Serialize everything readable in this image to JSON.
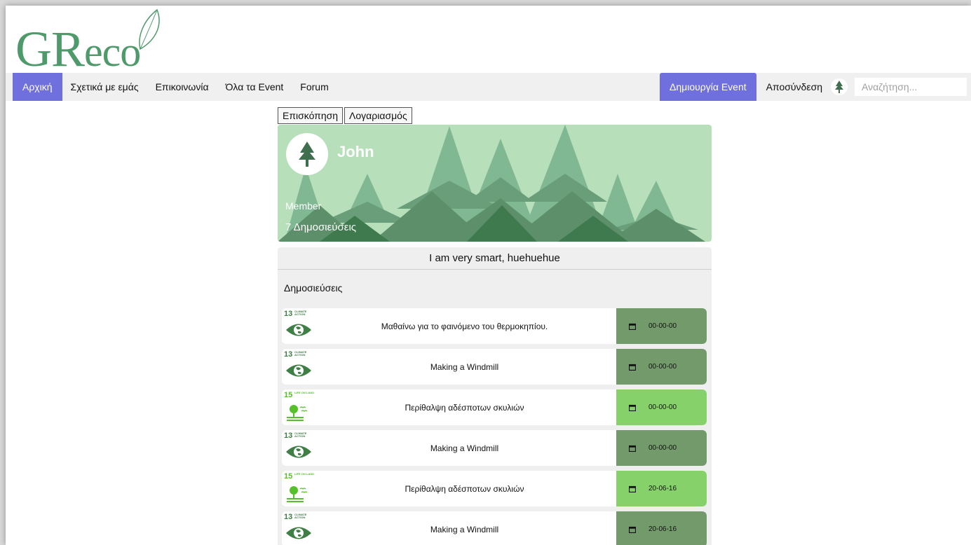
{
  "logo": {
    "text_main": "GR",
    "text_rest": "eco"
  },
  "nav": {
    "items": [
      {
        "label": "Αρχική",
        "active": true
      },
      {
        "label": "Σχετικά με εμάς",
        "active": false
      },
      {
        "label": "Επικοινωνία",
        "active": false
      },
      {
        "label": "Όλα τα Event",
        "active": false
      },
      {
        "label": "Forum",
        "active": false
      }
    ],
    "create_event_label": "Δημιουργία Event",
    "logout_label": "Αποσύνδεση",
    "search_placeholder": "Αναζήτηση..."
  },
  "tabs": [
    {
      "label": "Επισκόπηση"
    },
    {
      "label": "Λογαριασμός"
    }
  ],
  "profile": {
    "name": "John",
    "role": "Member",
    "posts_count": "7 Δημοσιεύσεις",
    "bio": "I am very smart, huehuehue"
  },
  "posts_heading": "Δημοσιεύσεις",
  "posts": [
    {
      "sdg": "13",
      "sdg_label": "CLIMATE ACTION",
      "icon": "eye-earth-icon",
      "title": "Μαθαίνω για το φαινόμενο του θερμοκηπίου.",
      "date": "00-00-00",
      "tone": "dark"
    },
    {
      "sdg": "13",
      "sdg_label": "CLIMATE ACTION",
      "icon": "eye-earth-icon",
      "title": "Making a Windmill",
      "date": "00-00-00",
      "tone": "dark"
    },
    {
      "sdg": "15",
      "sdg_label": "LIFE ON LAND",
      "icon": "tree-birds-icon",
      "title": "Περίθαλψη αδέσποτων σκυλιών",
      "date": "00-00-00",
      "tone": "light"
    },
    {
      "sdg": "13",
      "sdg_label": "CLIMATE ACTION",
      "icon": "eye-earth-icon",
      "title": "Making a Windmill",
      "date": "00-00-00",
      "tone": "dark"
    },
    {
      "sdg": "15",
      "sdg_label": "LIFE ON LAND",
      "icon": "tree-birds-icon",
      "title": "Περίθαλψη αδέσποτων σκυλιών",
      "date": "20-06-16",
      "tone": "light"
    },
    {
      "sdg": "13",
      "sdg_label": "CLIMATE ACTION",
      "icon": "eye-earth-icon",
      "title": "Making a Windmill",
      "date": "20-06-16",
      "tone": "dark"
    }
  ],
  "colors": {
    "accent": "#6f6fde",
    "brand_green": "#4f9a6b",
    "date_dark": "#739a6b",
    "date_light": "#86d16a",
    "sdg13": "#3f7e44",
    "sdg15": "#56c02b"
  }
}
